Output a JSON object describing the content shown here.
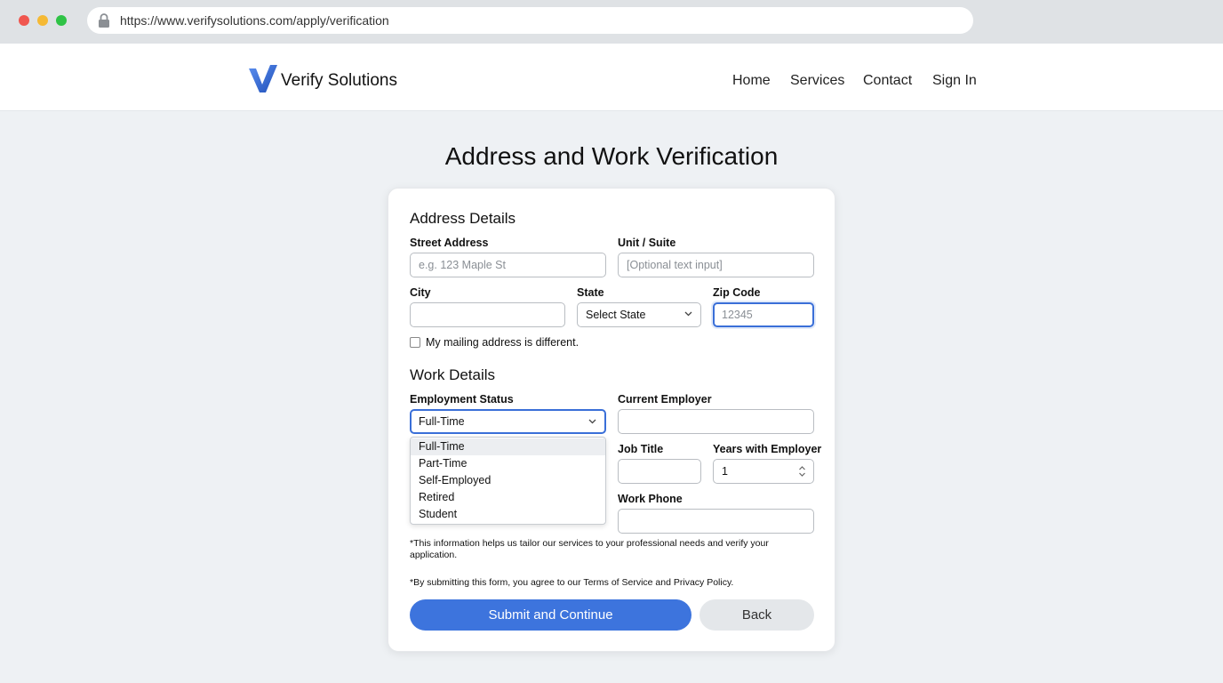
{
  "browser": {
    "url": "https://www.verifysolutions.com/apply/verification"
  },
  "header": {
    "brand": "Verify Solutions",
    "nav": [
      "Home",
      "Services",
      "Contact",
      "Sign In"
    ]
  },
  "page": {
    "title": "Address and Work Verification"
  },
  "address": {
    "title": "Address Details",
    "street_label": "Street Address",
    "street_placeholder": "e.g. 123 Maple St",
    "unit_label": "Unit / Suite",
    "unit_placeholder": "[Optional text input]",
    "city_label": "City",
    "state_label": "State",
    "state_value": "Select State",
    "zip_label": "Zip Code",
    "zip_placeholder": "12345",
    "mailing_label": "My mailing address is different."
  },
  "work": {
    "title": "Work Details",
    "status_label": "Employment Status",
    "status_value": "Full-Time",
    "status_options": [
      "Full-Time",
      "Part-Time",
      "Self-Employed",
      "Retired",
      "Student"
    ],
    "employer_label": "Current Employer",
    "job_label": "Job Title",
    "years_label": "Years with Employer",
    "years_value": "1",
    "phone_label": "Work Phone"
  },
  "notes": {
    "info": "*This information helps us tailor our services to your professional needs and verify your application.",
    "terms": "*By submitting this form, you agree to our Terms of Service and Privacy Policy."
  },
  "actions": {
    "submit": "Submit and Continue",
    "back": "Back"
  },
  "colors": {
    "accent": "#3d74dd",
    "focus": "#3a6fd8"
  }
}
